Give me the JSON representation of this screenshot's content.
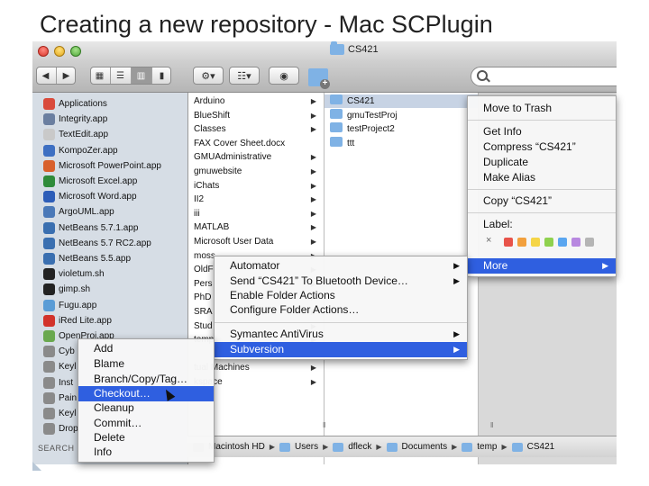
{
  "slide": {
    "title": "Creating a new repository - Mac SCPlugin"
  },
  "window": {
    "title": "CS421",
    "search_placeholder": ""
  },
  "toolbar": {
    "back_icon": "arrow-left-icon",
    "forward_icon": "arrow-right-icon",
    "view_icons": [
      "icon-view-icon",
      "list-view-icon",
      "column-view-icon",
      "coverflow-view-icon"
    ],
    "action_icon": "gear-icon",
    "arrange_icon": "arrange-icon",
    "quicklook_icon": "eye-icon"
  },
  "sidebar": {
    "items": [
      {
        "label": "Applications",
        "color": "#d94a3b"
      },
      {
        "label": "Integrity.app",
        "color": "#6b7fa0"
      },
      {
        "label": "TextEdit.app",
        "color": "#c9c9c9"
      },
      {
        "label": "KompoZer.app",
        "color": "#3d6fc2"
      },
      {
        "label": "Microsoft PowerPoint.app",
        "color": "#d8602c"
      },
      {
        "label": "Microsoft Excel.app",
        "color": "#2f8b3a"
      },
      {
        "label": "Microsoft Word.app",
        "color": "#2d5db8"
      },
      {
        "label": "ArgoUML.app",
        "color": "#4b79b8"
      },
      {
        "label": "NetBeans 5.7.1.app",
        "color": "#3a6fb0"
      },
      {
        "label": "NetBeans 5.7 RC2.app",
        "color": "#3a6fb0"
      },
      {
        "label": "NetBeans 5.5.app",
        "color": "#3a6fb0"
      },
      {
        "label": "violetum.sh",
        "color": "#222222"
      },
      {
        "label": "gimp.sh",
        "color": "#222222"
      },
      {
        "label": "Fugu.app",
        "color": "#5a9cd6"
      },
      {
        "label": "iRed Lite.app",
        "color": "#d2322a"
      },
      {
        "label": "OpenProj.app",
        "color": "#6aa84f"
      },
      {
        "label": "Cyb",
        "color": "#8a8a8a"
      },
      {
        "label": "Keyl",
        "color": "#8a8a8a"
      },
      {
        "label": "Inst",
        "color": "#8a8a8a"
      },
      {
        "label": "Pain",
        "color": "#8a8a8a"
      },
      {
        "label": "Keyl",
        "color": "#8a8a8a"
      },
      {
        "label": "Drop",
        "color": "#8a8a8a"
      }
    ],
    "search_for": "SEARCH"
  },
  "column1": {
    "items": [
      {
        "label": "Arduino",
        "folder": true
      },
      {
        "label": "BlueShift",
        "folder": true
      },
      {
        "label": "Classes",
        "folder": true
      },
      {
        "label": "FAX Cover Sheet.docx",
        "folder": false
      },
      {
        "label": "GMUAdministrative",
        "folder": true
      },
      {
        "label": "gmuwebsite",
        "folder": true
      },
      {
        "label": "iChats",
        "folder": true
      },
      {
        "label": "II2",
        "folder": true
      },
      {
        "label": "iii",
        "folder": true
      },
      {
        "label": "MATLAB",
        "folder": true
      },
      {
        "label": "Microsoft User Data",
        "folder": true
      },
      {
        "label": "moss",
        "folder": true
      },
      {
        "label": "OldF",
        "folder": true
      },
      {
        "label": "Pers",
        "folder": true
      },
      {
        "label": "PhD",
        "folder": true
      },
      {
        "label": "SRA",
        "folder": true
      },
      {
        "label": "Stud",
        "folder": true
      },
      {
        "label": "temp",
        "folder": true
      },
      {
        "label": "",
        "folder": true
      },
      {
        "label": "tual Machines",
        "folder": true
      },
      {
        "label": "kspace",
        "folder": true
      }
    ]
  },
  "column2": {
    "items": [
      {
        "label": "CS421",
        "selected": true
      },
      {
        "label": "gmuTestProj",
        "selected": false
      },
      {
        "label": "testProject2",
        "selected": false
      },
      {
        "label": "ttt",
        "selected": false
      }
    ]
  },
  "context_menu": {
    "items": [
      {
        "label": "Move to Trash"
      },
      {
        "label": "Get Info"
      },
      {
        "label": "Compress “CS421”"
      },
      {
        "label": "Duplicate"
      },
      {
        "label": "Make Alias"
      },
      {
        "label": "Copy “CS421”"
      },
      {
        "label": "Label:"
      },
      {
        "label": "More"
      }
    ],
    "label_colors": [
      "#e8534a",
      "#f2a03d",
      "#f5d547",
      "#8fd14f",
      "#5aa6f0",
      "#b888e0",
      "#b5b5b5"
    ]
  },
  "more_menu": {
    "items": [
      {
        "label": "Automator"
      },
      {
        "label": "Send “CS421” To Bluetooth Device…"
      },
      {
        "label": "Enable Folder Actions"
      },
      {
        "label": "Configure Folder Actions…"
      },
      {
        "label": "Symantec AntiVirus"
      },
      {
        "label": "Subversion"
      }
    ]
  },
  "svn_menu": {
    "items": [
      {
        "label": "Add"
      },
      {
        "label": "Blame"
      },
      {
        "label": "Branch/Copy/Tag…"
      },
      {
        "label": "Checkout…"
      },
      {
        "label": "Cleanup"
      },
      {
        "label": "Commit…"
      },
      {
        "label": "Delete"
      },
      {
        "label": "Info"
      }
    ]
  },
  "pathbar": {
    "items": [
      "Macintosh HD",
      "Users",
      "dfleck",
      "Documents",
      "temp",
      "CS421"
    ]
  }
}
